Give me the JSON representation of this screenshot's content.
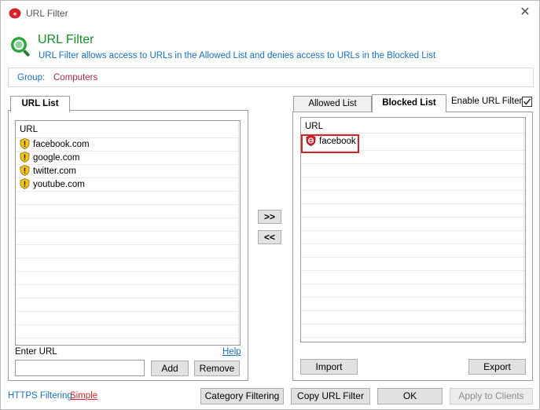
{
  "window": {
    "title": "URL Filter"
  },
  "header": {
    "title": "URL Filter",
    "description": "URL Filter allows access to URLs in the Allowed List and denies access to URLs in the Blocked List"
  },
  "group": {
    "label": "Group:",
    "value": "Computers"
  },
  "left_panel": {
    "tab": "URL List",
    "column": "URL",
    "items": [
      "facebook.com",
      "google.com",
      "twitter.com",
      "youtube.com"
    ],
    "enter_url_label": "Enter URL",
    "help_link": "Help",
    "add_button": "Add",
    "remove_button": "Remove"
  },
  "transfer": {
    "add_all": ">>",
    "remove_all": "<<"
  },
  "right_panel": {
    "tabs": [
      "Allowed List",
      "Blocked List"
    ],
    "active_tab": "Blocked List",
    "enable_label": "Enable URL Filter",
    "enable_checked": true,
    "column": "URL",
    "items": [
      "facebook"
    ],
    "import_button": "Import",
    "export_button": "Export"
  },
  "footer": {
    "https_label": "HTTPS Filtering:",
    "https_value": "Simple",
    "category_button": "Category Filtering",
    "copy_button": "Copy URL Filter",
    "ok_button": "OK",
    "apply_button": "Apply to Clients"
  },
  "colors": {
    "accent_green": "#1a8a2a",
    "link_blue": "#1b6fb5",
    "highlight_red": "#d2232a",
    "group_value": "#9e2a4a"
  }
}
